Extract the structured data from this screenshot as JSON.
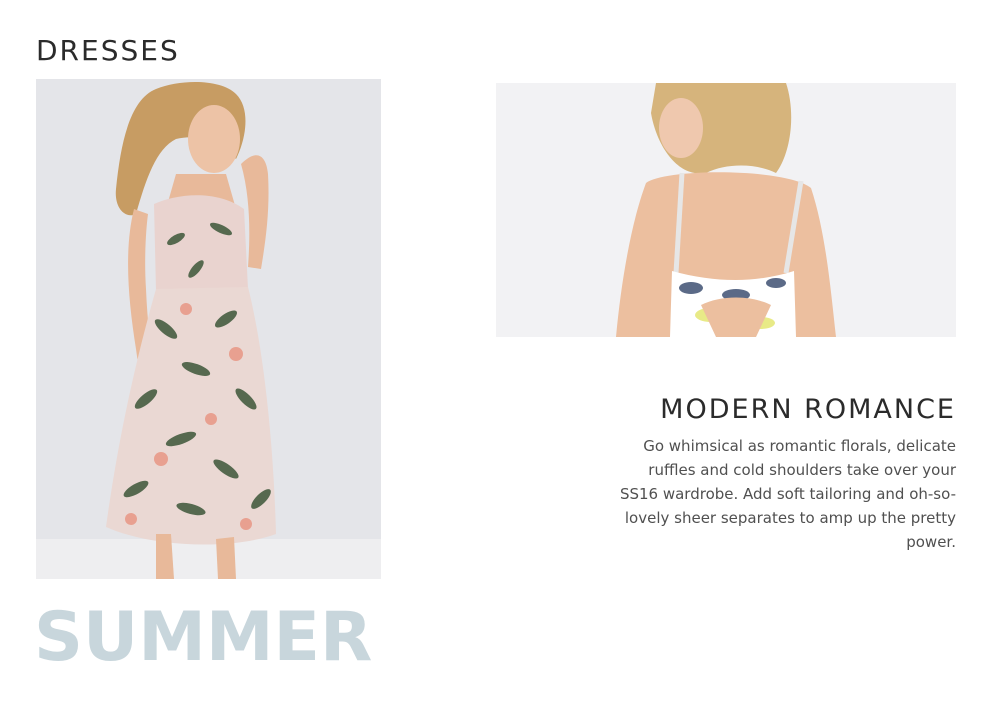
{
  "section": {
    "title": "DRESSES"
  },
  "images": {
    "main_alt": "Model wearing a floral halter midi dress",
    "back_alt": "Back view of a printed dress with cross straps"
  },
  "feature": {
    "title": "MODERN ROMANCE",
    "body_lines": [
      "Go whimsical as romantic florals, delicate",
      "ruffles and cold shoulders take over your",
      "SS16 wardrobe. Add soft tailoring and oh-so-",
      "lovely sheer separates to amp up the pretty",
      "power."
    ]
  },
  "season": {
    "word": "SUMMER"
  },
  "colors": {
    "season_word": "#c8d6dc",
    "heading": "#2b2b2b",
    "body_text": "#505050"
  }
}
